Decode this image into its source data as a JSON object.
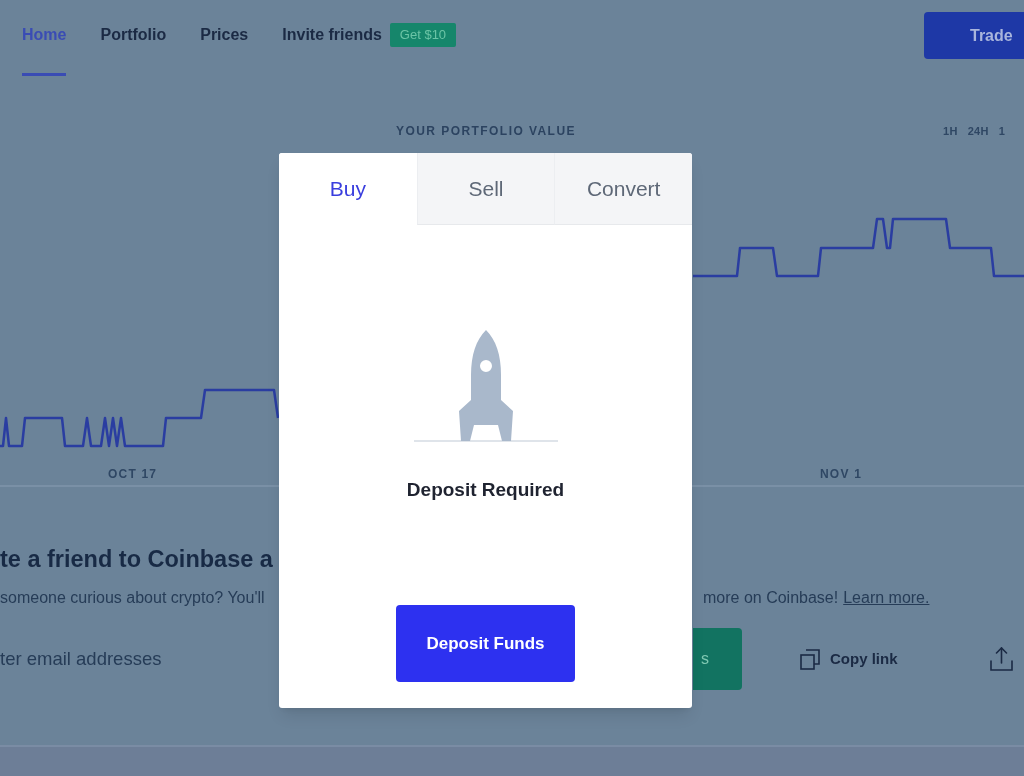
{
  "nav": {
    "items": [
      {
        "label": "Home",
        "selected": true
      },
      {
        "label": "Portfolio",
        "selected": false
      },
      {
        "label": "Prices",
        "selected": false
      },
      {
        "label": "Invite friends",
        "selected": false,
        "badge": "Get $10"
      }
    ],
    "trade_button": "Trade"
  },
  "portfolio": {
    "title": "YOUR PORTFOLIO VALUE",
    "time_ranges": [
      "1H",
      "24H",
      "1"
    ],
    "date_labels": [
      "OCT 17",
      "NOV 1"
    ]
  },
  "invite": {
    "heading": "te a friend to Coinbase a",
    "description_left": "someone curious about crypto? You'll",
    "description_right": "more on Coinbase!",
    "link": "Learn more.",
    "email_placeholder": "ter email addresses",
    "send_button": "s",
    "copy_link": "Copy link"
  },
  "modal": {
    "tabs": [
      {
        "label": "Buy",
        "selected": true
      },
      {
        "label": "Sell",
        "selected": false
      },
      {
        "label": "Convert",
        "selected": false
      }
    ],
    "message": "Deposit Required",
    "button": "Deposit Funds"
  }
}
